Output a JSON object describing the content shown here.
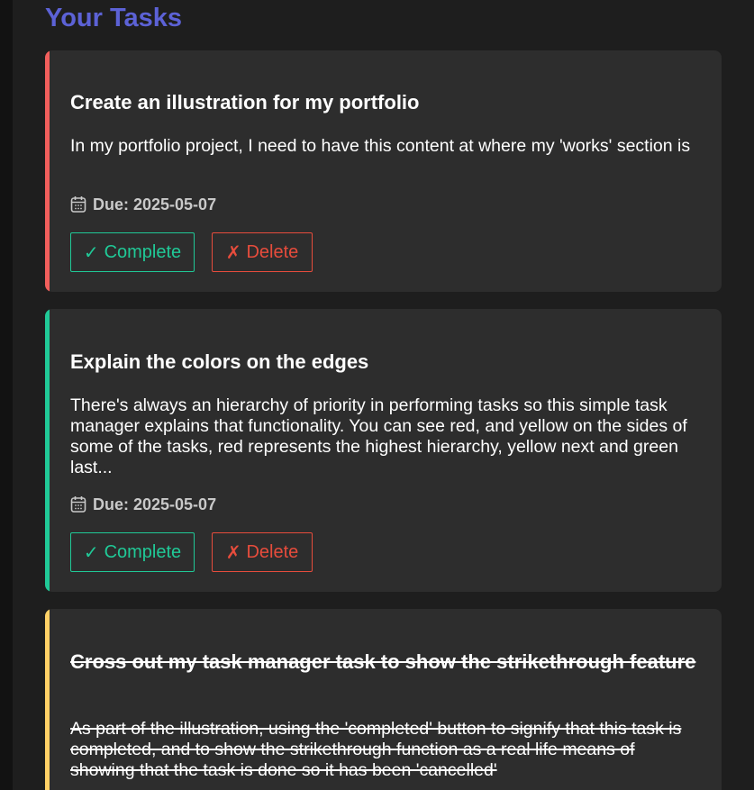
{
  "page": {
    "heading": "Your Tasks"
  },
  "colors": {
    "heading": "#5c62d6",
    "priority_high": "#f25f5c",
    "priority_low": "#20c997",
    "priority_medium": "#ffd166",
    "complete_button": "#20c997",
    "delete_button": "#e74c3c",
    "card_background": "#2d2d2d"
  },
  "tasks": [
    {
      "title": "Create an illustration for my portfolio",
      "description": "In my portfolio project, I need to have this content at where my 'works' section is",
      "due_label": "Due: 2025-05-07",
      "priority_color": "#f25f5c",
      "completed": false,
      "complete_icon": "✓",
      "complete_label": "Complete",
      "delete_icon": "✗",
      "delete_label": "Delete"
    },
    {
      "title": "Explain the colors on the edges",
      "description": "There's always an hierarchy of priority in performing tasks so this simple task manager explains that functionality. You can see red, and yellow on the sides of some of the tasks, red represents the highest hierarchy, yellow next and green last...",
      "due_label": "Due: 2025-05-07",
      "priority_color": "#20c997",
      "completed": false,
      "complete_icon": "✓",
      "complete_label": "Complete",
      "delete_icon": "✗",
      "delete_label": "Delete"
    },
    {
      "title": "Cross out my task manager task to show the strikethrough feature",
      "description": "As part of the illustration, using the 'completed' button to signify that this task is completed, and to show the strikethrough function as a real life means of showing that the task is done so it has been 'cancelled'",
      "priority_color": "#ffd166",
      "completed": true
    }
  ],
  "icons": {
    "due": "calendar-icon"
  }
}
